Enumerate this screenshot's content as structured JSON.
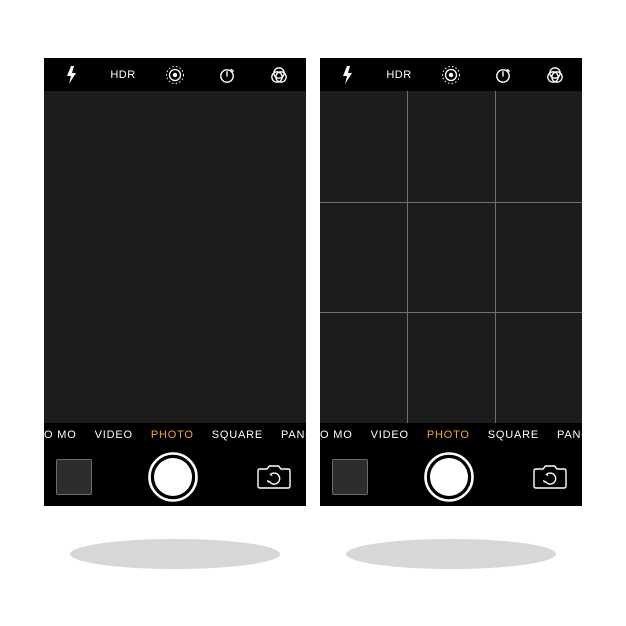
{
  "colors": {
    "accent": "#f5a623",
    "bg": "#000000",
    "viewfinder": "#1c1c1c",
    "grid_line": "#707070",
    "text": "#ffffff",
    "shadow": "#d7d7d7"
  },
  "icons": {
    "flash": "flash-icon",
    "hdr": "hdr-icon",
    "live": "live-photo-icon",
    "timer": "timer-icon",
    "filters": "filters-icon",
    "shutter": "shutter-icon",
    "camera_swap": "camera-swap-icon",
    "thumbnail": "last-photo-thumbnail"
  },
  "top_bar": {
    "hdr_label": "HDR"
  },
  "modes": {
    "items": [
      {
        "label": "SLO MO",
        "edge": "left"
      },
      {
        "label": "VIDEO"
      },
      {
        "label": "PHOTO",
        "selected": true
      },
      {
        "label": "SQUARE"
      },
      {
        "label": "PANO",
        "edge": "right"
      }
    ]
  },
  "screens": [
    {
      "id": "camera-no-grid",
      "show_flash_badge": true,
      "show_grid": false
    },
    {
      "id": "camera-with-grid",
      "show_flash_badge": false,
      "show_grid": true
    }
  ]
}
